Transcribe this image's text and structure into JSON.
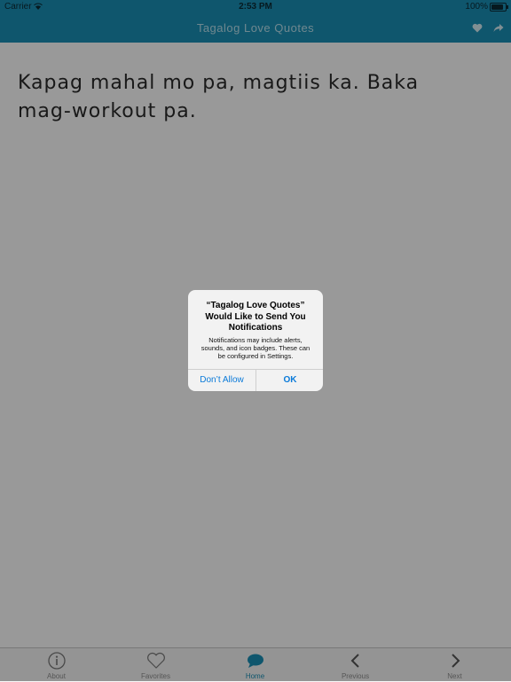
{
  "status_bar": {
    "carrier": "Carrier",
    "time": "2:53 PM",
    "battery_text": "100%",
    "battery_level": 1.0
  },
  "nav": {
    "title": "Tagalog Love Quotes",
    "heart_icon": "heart-icon",
    "share_icon": "share-icon"
  },
  "quote": {
    "text": "Kapag mahal mo pa, magtiis ka. Baka mag-workout pa."
  },
  "tabs": [
    {
      "label": "About",
      "icon": "info-icon",
      "active": false
    },
    {
      "label": "Favorites",
      "icon": "heart-outline-icon",
      "active": false
    },
    {
      "label": "Home",
      "icon": "chat-bubble-icon",
      "active": true
    },
    {
      "label": "Previous",
      "icon": "chevron-left-icon",
      "active": false
    },
    {
      "label": "Next",
      "icon": "chevron-right-icon",
      "active": false
    }
  ],
  "alert": {
    "title": "“Tagalog Love Quotes” Would Like to Send You Notifications",
    "message": "Notifications may include alerts, sounds, and icon badges. These can be configured in Settings.",
    "dont_allow_label": "Don’t Allow",
    "ok_label": "OK"
  },
  "colors": {
    "accent": "#1a8fb6",
    "alert_button": "#0a7ad9"
  }
}
